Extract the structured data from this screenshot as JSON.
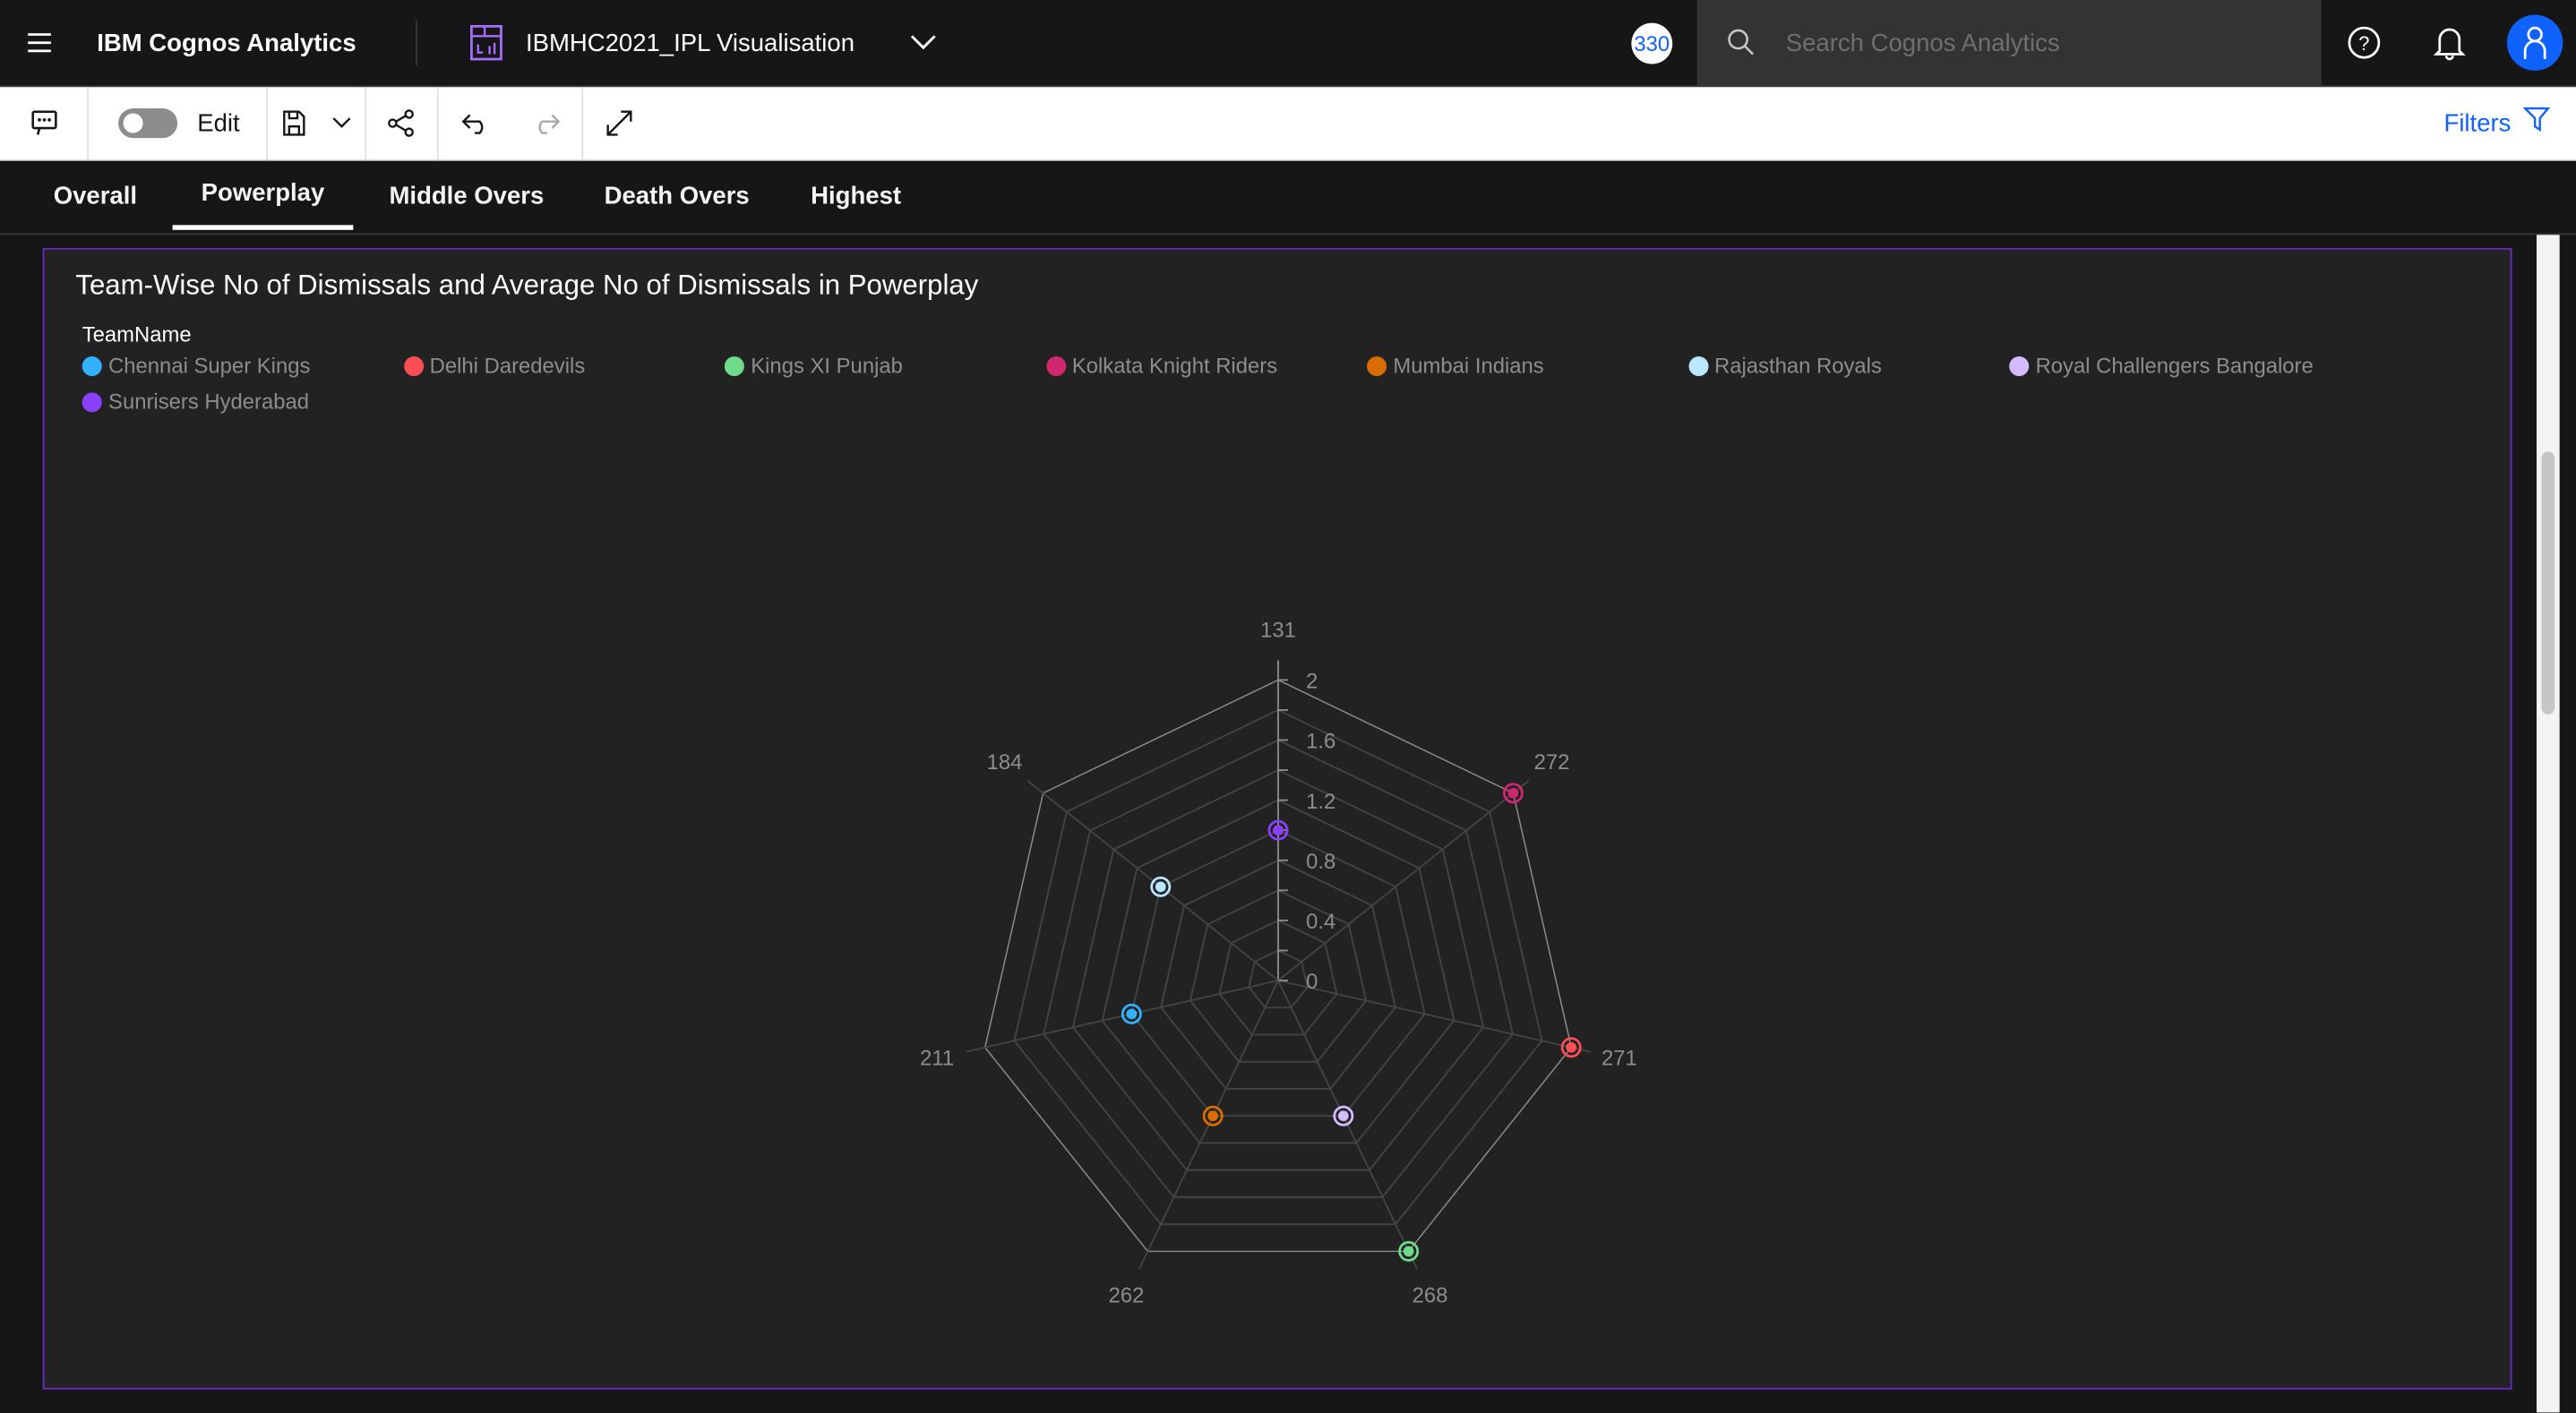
{
  "header": {
    "brand": "IBM Cognos Analytics",
    "report_title": "IBMHC2021_IPL Visualisation",
    "badge": "330",
    "search_placeholder": "Search Cognos Analytics"
  },
  "toolbar": {
    "edit_label": "Edit",
    "edit_on": false,
    "filters_label": "Filters"
  },
  "tabs": [
    {
      "label": "Overall"
    },
    {
      "label": "Powerplay",
      "active": true
    },
    {
      "label": "Middle Overs"
    },
    {
      "label": "Death Overs"
    },
    {
      "label": "Highest"
    }
  ],
  "colors": {
    "accent": "#0f62fe",
    "panel_border": "#6929c4"
  },
  "chart_data": {
    "type": "radar",
    "title": "Team-Wise No of Dismissals and Average No of Dismissals in Powerplay",
    "legend_title": "TeamName",
    "legend_placement": "top-left",
    "axes": [
      "131",
      "272",
      "271",
      "268",
      "262",
      "211",
      "184"
    ],
    "radial_range": [
      0,
      2
    ],
    "radial_ticks": [
      "0",
      "0.4",
      "0.8",
      "1.2",
      "1.6",
      "2"
    ],
    "grid": true,
    "series": [
      {
        "name": "Chennai Super Kings",
        "color": "#33b1ff",
        "axis": "211",
        "value": 1
      },
      {
        "name": "Delhi Daredevils",
        "color": "#fa4d56",
        "axis": "271",
        "value": 2
      },
      {
        "name": "Kings XI Punjab",
        "color": "#6fdc8c",
        "axis": "268",
        "value": 2
      },
      {
        "name": "Kolkata Knight Riders",
        "color": "#d12771",
        "axis": "272",
        "value": 2
      },
      {
        "name": "Mumbai Indians",
        "color": "#d96d04",
        "axis": "262",
        "value": 1
      },
      {
        "name": "Rajasthan Royals",
        "color": "#bae6ff",
        "axis": "184",
        "value": 1
      },
      {
        "name": "Royal Challengers Bangalore",
        "color": "#d4bbff",
        "axis": "268",
        "value": 1
      },
      {
        "name": "Sunrisers Hyderabad",
        "color": "#8a3ffc",
        "axis": "131",
        "value": 1
      }
    ]
  }
}
